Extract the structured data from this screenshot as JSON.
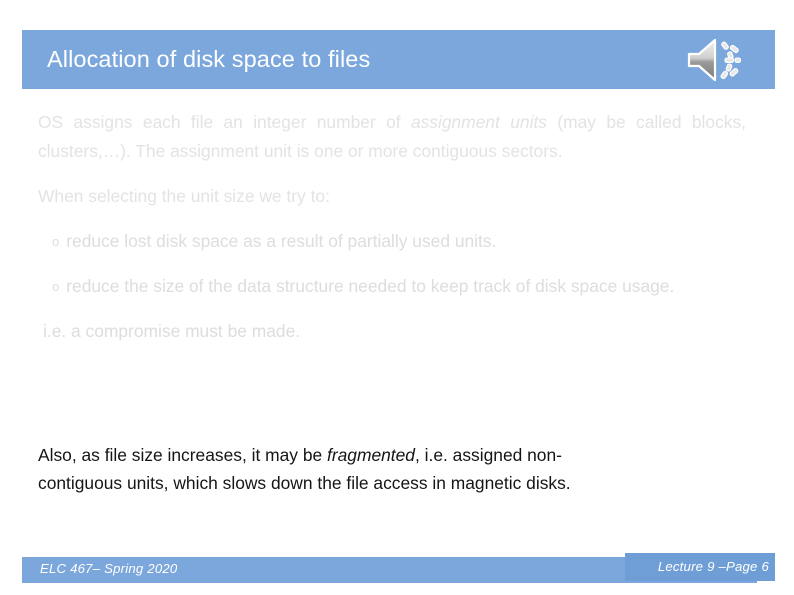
{
  "slide": {
    "title": "Allocation of disk space to files",
    "title_icon": "speaker-audio-icon",
    "accent_color": "#7ba7dc",
    "body": {
      "paragraph_1_part_1": "OS assigns each file an integer number of ",
      "paragraph_1_italic": "assignment units",
      "paragraph_1_part_2": " (may be called blocks, clusters,…). The assignment unit is one or more contiguous sectors.",
      "paragraph_2": "When selecting the unit size we try to:",
      "bullet_marker": "o",
      "bullet_1": "reduce lost disk space as a result of partially used units.",
      "bullet_2": "reduce the size of the data structure needed to keep track of disk space usage.",
      "paragraph_3": "i.e. a compromise must be made.",
      "paragraph_4_part_1": "Also, as file size increases, it may be ",
      "paragraph_4_italic": "fragmented",
      "paragraph_4_part_2": ", i.e. assigned non-",
      "paragraph_4_lastline": "contiguous units, which slows down the file access in magnetic disks."
    },
    "footer": {
      "left": "ELC 467– Spring 2020",
      "right": "Lecture 9 –Page 6"
    }
  }
}
